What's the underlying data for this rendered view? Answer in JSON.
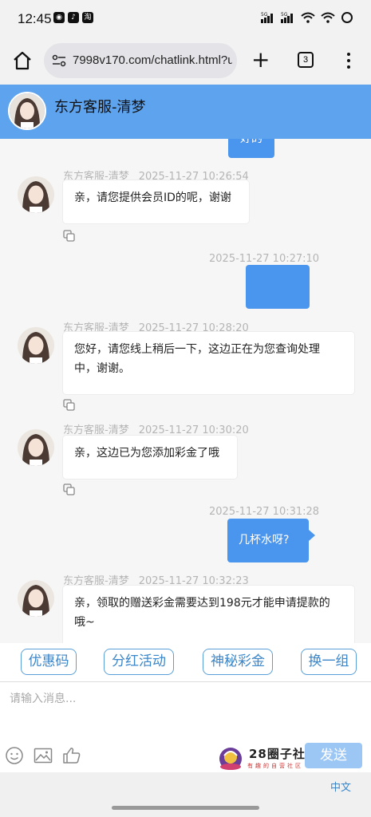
{
  "status_bar": {
    "time": "12:45",
    "app_icons": [
      "wechat",
      "tiktok",
      "taobao"
    ],
    "signal_labels": [
      "5G",
      "5G"
    ]
  },
  "browser": {
    "url": "7998v170.com/chatlink.html?ui",
    "tab_count": "3"
  },
  "chat": {
    "header_title": "东方客服-清梦",
    "messages": [
      {
        "side": "right",
        "text": "好的",
        "partial": true
      },
      {
        "side": "left",
        "sender": "东方客服-清梦",
        "time": "2025-11-27 10:26:54",
        "text": "亲，请您提供会员ID的呢，谢谢"
      },
      {
        "side": "right",
        "time": "2025-11-27 10:27:10",
        "text": "",
        "redacted": true
      },
      {
        "side": "left",
        "sender": "东方客服-清梦",
        "time": "2025-11-27 10:28:20",
        "lines": [
          "您好，请您线上稍后一下，这边正在为您查询处理",
          "中，谢谢。"
        ]
      },
      {
        "side": "left",
        "sender": "东方客服-清梦",
        "time": "2025-11-27 10:30:20",
        "text": "亲，这边已为您添加彩金了哦"
      },
      {
        "side": "right",
        "time": "2025-11-27 10:31:28",
        "text": "几杯水呀?"
      },
      {
        "side": "left",
        "sender": "东方客服-清梦",
        "time": "2025-11-27 10:32:23",
        "lines": [
          "亲，领取的赠送彩金需要达到198元才能申请提款的",
          "哦~"
        ]
      }
    ]
  },
  "quick_replies": [
    "优惠码",
    "分红活动",
    "神秘彩金",
    "换一组"
  ],
  "input": {
    "placeholder": "请输入消息...",
    "send_label": "发送",
    "tools": [
      "emoji-icon",
      "image-icon",
      "thumbs-up-icon"
    ]
  },
  "watermark": {
    "title": "28圈子社区",
    "subtitle": "有趣的自营社区"
  },
  "footer": {
    "language": "中文"
  },
  "colors": {
    "header_bg": "#5da3ee",
    "bubble_right": "#4a95ee",
    "quick_border": "#5a9fd8",
    "send_bg": "#9cc7f5"
  }
}
